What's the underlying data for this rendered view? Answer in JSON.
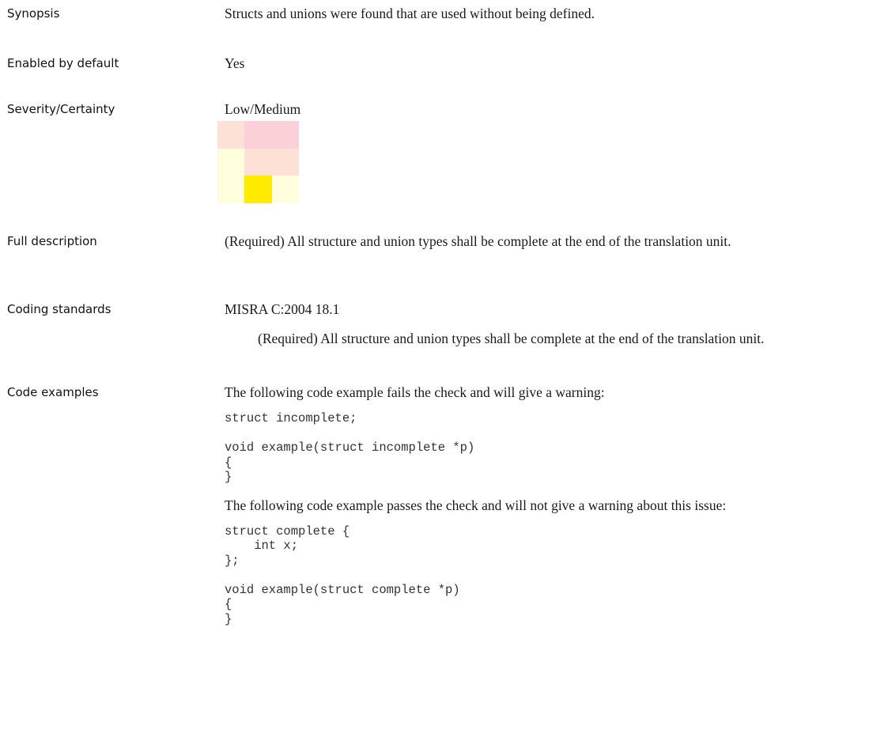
{
  "sections": {
    "synopsis": {
      "label": "Synopsis",
      "text": "Structs and unions were found that are used without being defined."
    },
    "enabled": {
      "label": "Enabled by default",
      "text": "Yes"
    },
    "severity": {
      "label": "Severity/Certainty",
      "text": "Low/Medium",
      "matrix_colors": [
        [
          "#fde0d6",
          "#fbd0d6",
          "#fbd0d6"
        ],
        [
          "#fefedd",
          "#fde0d6",
          "#fde0d6"
        ],
        [
          "#fefedd",
          "#ffea00",
          "#fefedd"
        ]
      ]
    },
    "full_description": {
      "label": "Full description",
      "text": "(Required) All structure and union types shall be complete at the end of the translation unit."
    },
    "coding_standards": {
      "label": "Coding standards",
      "standard": "MISRA C:2004 18.1",
      "rule_text": "(Required) All structure and union types shall be complete at the end of the translation unit."
    },
    "code_examples": {
      "label": "Code examples",
      "fail_intro": "The following code example fails the check and will give a warning:",
      "fail_code": "struct incomplete;\n\nvoid example(struct incomplete *p)\n{\n}",
      "pass_intro": "The following code example passes the check and will not give a warning about this issue:",
      "pass_code": "struct complete {\n    int x;\n};\n\nvoid example(struct complete *p)\n{\n}"
    }
  }
}
